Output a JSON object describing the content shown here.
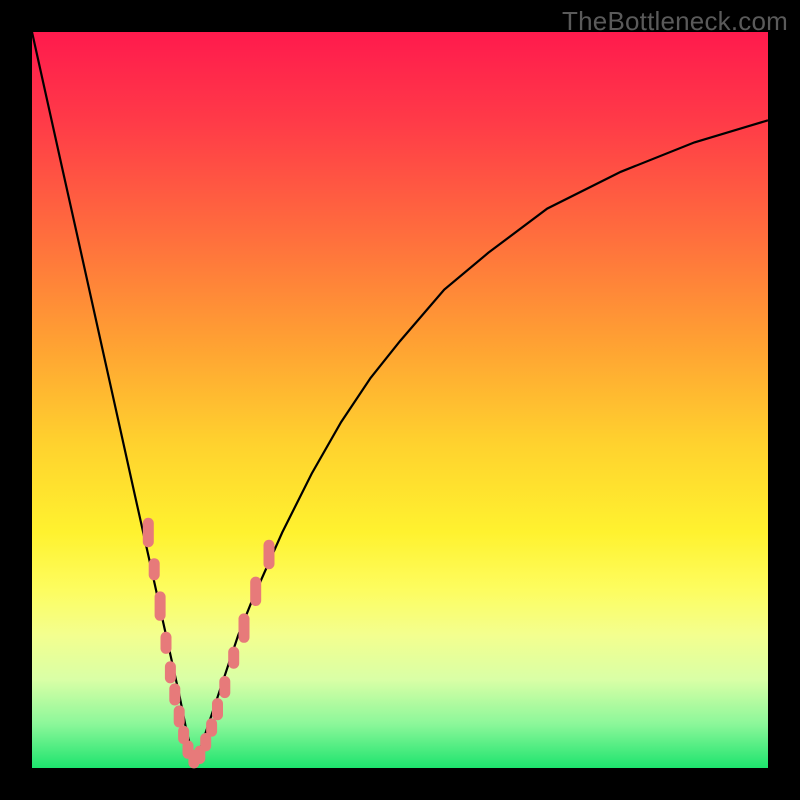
{
  "watermark": "TheBottleneck.com",
  "colors": {
    "frame": "#000000",
    "curve": "#000000",
    "marker": "#e77a7a",
    "gradient_stops": [
      {
        "pct": 0,
        "hex": "#ff1a4d"
      },
      {
        "pct": 12,
        "hex": "#ff3a48"
      },
      {
        "pct": 28,
        "hex": "#ff6f3d"
      },
      {
        "pct": 42,
        "hex": "#ffa033"
      },
      {
        "pct": 56,
        "hex": "#ffd22e"
      },
      {
        "pct": 68,
        "hex": "#fff22f"
      },
      {
        "pct": 76,
        "hex": "#fdfd61"
      },
      {
        "pct": 82,
        "hex": "#f3ff8f"
      },
      {
        "pct": 88,
        "hex": "#d9ffa6"
      },
      {
        "pct": 94,
        "hex": "#8cf79a"
      },
      {
        "pct": 100,
        "hex": "#1de46e"
      }
    ]
  },
  "chart_data": {
    "type": "line",
    "title": "",
    "xlabel": "",
    "ylabel": "",
    "xlim": [
      0,
      100
    ],
    "ylim": [
      0,
      100
    ],
    "grid": false,
    "legend": false,
    "series": [
      {
        "name": "bottleneck-curve",
        "description": "V-shaped bottleneck percentage curve; minimum near x≈22 at y≈0, rising steeply on both sides.",
        "x": [
          0,
          2,
          4,
          6,
          8,
          10,
          12,
          14,
          16,
          18,
          20,
          21,
          22,
          23,
          24,
          26,
          28,
          30,
          34,
          38,
          42,
          46,
          50,
          56,
          62,
          70,
          80,
          90,
          100
        ],
        "y": [
          100,
          91,
          82,
          73,
          64,
          55,
          46,
          37,
          28,
          19,
          10,
          5,
          1,
          3,
          6,
          12,
          18,
          23,
          32,
          40,
          47,
          53,
          58,
          65,
          70,
          76,
          81,
          85,
          88
        ]
      }
    ],
    "markers": {
      "name": "highlighted-points",
      "description": "Salmon pill markers clustered around the trough of the curve.",
      "points": [
        {
          "x": 15.8,
          "y": 32,
          "len": 4
        },
        {
          "x": 16.6,
          "y": 27,
          "len": 3
        },
        {
          "x": 17.4,
          "y": 22,
          "len": 4
        },
        {
          "x": 18.2,
          "y": 17,
          "len": 3
        },
        {
          "x": 18.8,
          "y": 13,
          "len": 3
        },
        {
          "x": 19.4,
          "y": 10,
          "len": 3
        },
        {
          "x": 20.0,
          "y": 7,
          "len": 3
        },
        {
          "x": 20.6,
          "y": 4.5,
          "len": 2.5
        },
        {
          "x": 21.2,
          "y": 2.5,
          "len": 2.5
        },
        {
          "x": 22.0,
          "y": 1.2,
          "len": 2.5
        },
        {
          "x": 22.8,
          "y": 1.8,
          "len": 2.5
        },
        {
          "x": 23.6,
          "y": 3.5,
          "len": 2.5
        },
        {
          "x": 24.4,
          "y": 5.5,
          "len": 2.5
        },
        {
          "x": 25.2,
          "y": 8,
          "len": 3
        },
        {
          "x": 26.2,
          "y": 11,
          "len": 3
        },
        {
          "x": 27.4,
          "y": 15,
          "len": 3
        },
        {
          "x": 28.8,
          "y": 19,
          "len": 4
        },
        {
          "x": 30.4,
          "y": 24,
          "len": 4
        },
        {
          "x": 32.2,
          "y": 29,
          "len": 4
        }
      ]
    }
  }
}
